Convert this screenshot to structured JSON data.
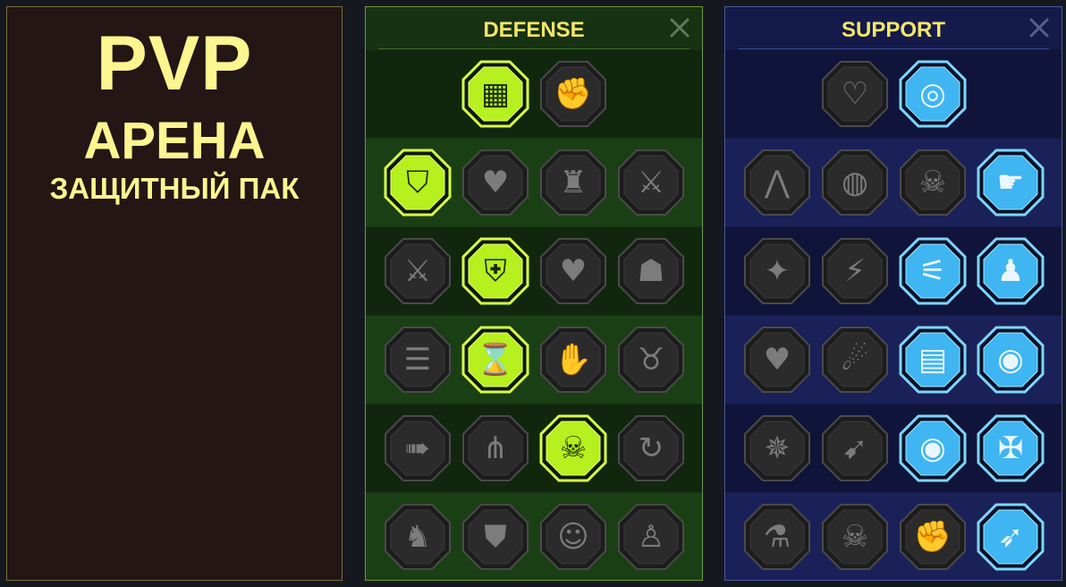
{
  "title": {
    "line1": "PVP",
    "line2": "АРЕНА",
    "line3": "ЗАЩИТНЫЙ ПАК"
  },
  "colors": {
    "title_text": "#fdf590",
    "header_text": "#f3e56b",
    "active_green": "#b6f01e",
    "active_blue": "#3fb5f2",
    "inactive": "#2b2b2b"
  },
  "defense": {
    "header": "DEFENSE",
    "rows": [
      [
        {
          "icon": "stacked-plates-icon",
          "active": true
        },
        {
          "icon": "raised-fist-icon",
          "active": false
        }
      ],
      [
        {
          "icon": "shield-chevrons-icon",
          "active": true
        },
        {
          "icon": "anatomical-heart-icon",
          "active": false
        },
        {
          "icon": "stone-golem-icon",
          "active": false
        },
        {
          "icon": "crossed-blades-icon",
          "active": false
        }
      ],
      [
        {
          "icon": "duelists-icon",
          "active": false
        },
        {
          "icon": "knight-shield-icon",
          "active": true
        },
        {
          "icon": "heart-icon",
          "active": false
        },
        {
          "icon": "hooded-figure-icon",
          "active": false
        }
      ],
      [
        {
          "icon": "crowd-icon",
          "active": false
        },
        {
          "icon": "hourglass-skull-icon",
          "active": true
        },
        {
          "icon": "open-palm-icon",
          "active": false
        },
        {
          "icon": "bull-head-icon",
          "active": false
        }
      ],
      [
        {
          "icon": "dashing-figure-icon",
          "active": false
        },
        {
          "icon": "claw-marks-icon",
          "active": false
        },
        {
          "icon": "radiant-skull-icon",
          "active": true
        },
        {
          "icon": "hand-swirl-icon",
          "active": false
        }
      ],
      [
        {
          "icon": "armored-warrior-icon",
          "active": false
        },
        {
          "icon": "winged-shield-icon",
          "active": false
        },
        {
          "icon": "bearded-face-icon",
          "active": false
        },
        {
          "icon": "muscular-figure-icon",
          "active": false
        }
      ]
    ]
  },
  "support": {
    "header": "SUPPORT",
    "rows": [
      [
        {
          "icon": "heart-plus-icon",
          "active": false
        },
        {
          "icon": "target-burst-icon",
          "active": true
        }
      ],
      [
        {
          "icon": "praying-hands-icon",
          "active": false
        },
        {
          "icon": "aura-shield-icon",
          "active": false
        },
        {
          "icon": "smoking-skull-icon",
          "active": false
        },
        {
          "icon": "healing-hand-icon",
          "active": true
        }
      ],
      [
        {
          "icon": "sparkle-figure-icon",
          "active": false
        },
        {
          "icon": "lightning-bolt-icon",
          "active": false
        },
        {
          "icon": "cracked-ground-icon",
          "active": true
        },
        {
          "icon": "afterimage-figure-icon",
          "active": true
        }
      ],
      [
        {
          "icon": "chained-heart-icon",
          "active": false
        },
        {
          "icon": "comet-icon",
          "active": false
        },
        {
          "icon": "open-book-icon",
          "active": true
        },
        {
          "icon": "angry-eyes-icon",
          "active": true
        }
      ],
      [
        {
          "icon": "compass-star-icon",
          "active": false
        },
        {
          "icon": "running-boot-icon",
          "active": false
        },
        {
          "icon": "all-seeing-eye-icon",
          "active": true
        },
        {
          "icon": "voodoo-doll-icon",
          "active": true
        }
      ],
      [
        {
          "icon": "potion-flask-icon",
          "active": false
        },
        {
          "icon": "horned-skull-icon",
          "active": false
        },
        {
          "icon": "fist-smash-icon",
          "active": false
        },
        {
          "icon": "eagle-head-icon",
          "active": true
        }
      ]
    ]
  }
}
